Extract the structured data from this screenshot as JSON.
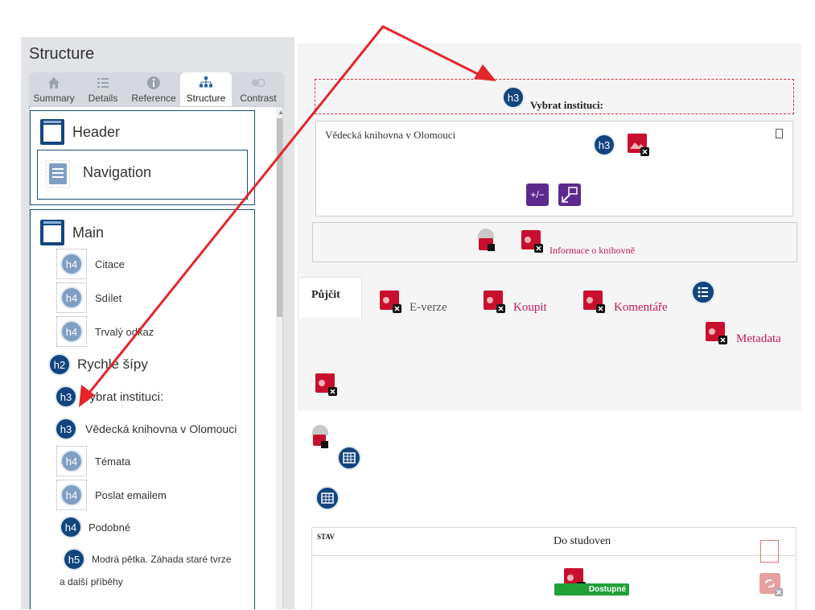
{
  "sidebar": {
    "title": "Structure",
    "tabs": [
      {
        "label": "Summary",
        "icon": "home-icon"
      },
      {
        "label": "Details",
        "icon": "list-icon"
      },
      {
        "label": "Reference",
        "icon": "info-icon"
      },
      {
        "label": "Structure",
        "icon": "sitemap-icon",
        "active": true
      },
      {
        "label": "Contrast",
        "icon": "contrast-icon"
      }
    ],
    "regions": {
      "header": "Header",
      "navigation": "Navigation",
      "main": "Main"
    },
    "headings": [
      {
        "level": "h4",
        "text": "Citace",
        "style": "light"
      },
      {
        "level": "h4",
        "text": "Sdílet",
        "style": "light"
      },
      {
        "level": "h4",
        "text": "Trvalý odkaz",
        "style": "light"
      },
      {
        "level": "h2",
        "text": "Rychlé šípy",
        "style": "dark"
      },
      {
        "level": "h3",
        "text": "Vybrat instituci:",
        "style": "dark"
      },
      {
        "level": "h3",
        "text": "Vědecká knihovna v Olomouci",
        "style": "dark"
      },
      {
        "level": "h4",
        "text": "Témata",
        "style": "light"
      },
      {
        "level": "h4",
        "text": "Poslat emailem",
        "style": "light"
      },
      {
        "level": "h4",
        "text": "Podobné",
        "style": "dark"
      },
      {
        "level": "h5",
        "text": "Modrá pětka. Záhada staré tvrze",
        "style": "dark"
      }
    ],
    "h5_continuation": "a další příběhy"
  },
  "page": {
    "select_institution_label": "Vybrat instituci:",
    "library_name": "Vědecká knihovna v Olomouci",
    "badge_h3": "h3",
    "plus_minus": "+/−",
    "library_info_link": "Informace o knihovně",
    "tabs": {
      "borrow": "Půjčit",
      "ebook": "E-verze",
      "buy": "Koupit",
      "comments": "Komentáře",
      "metadata": "Metadata"
    },
    "table": {
      "status_header": "STAV",
      "location": "Do studoven",
      "availability": "Dostupné"
    }
  },
  "colors": {
    "annotation_arrow": "#e3262b",
    "heading_dark": "#12457e",
    "heading_light": "#7f9fc4",
    "link": "#c2185b",
    "available_green": "#21a038"
  }
}
